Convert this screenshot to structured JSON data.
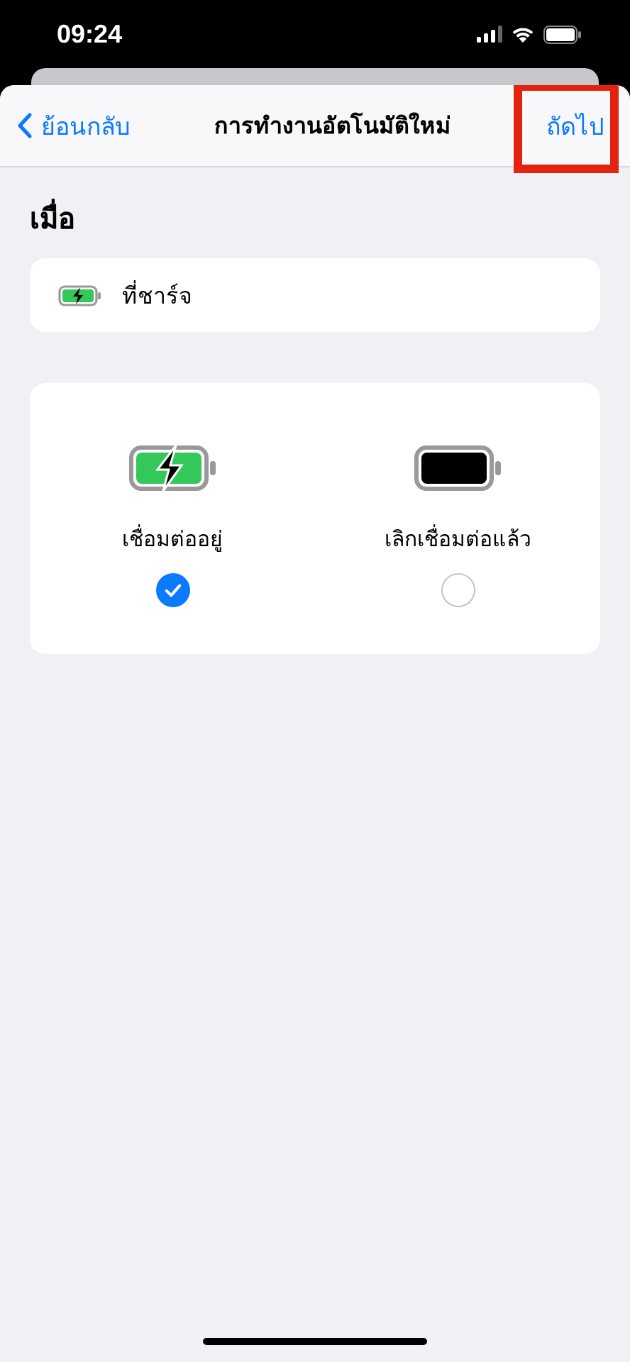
{
  "status_bar": {
    "time": "09:24"
  },
  "nav": {
    "back": "ย้อนกลับ",
    "title": "การทำงานอัตโนมัติใหม่",
    "next": "ถัดไป"
  },
  "section": {
    "heading": "เมื่อ",
    "trigger": "ที่ชาร์จ"
  },
  "options": [
    {
      "kind": "charging",
      "label": "เชื่อมต่ออยู่",
      "selected": true
    },
    {
      "kind": "full",
      "label": "เลิกเชื่อมต่อแล้ว",
      "selected": false
    }
  ]
}
